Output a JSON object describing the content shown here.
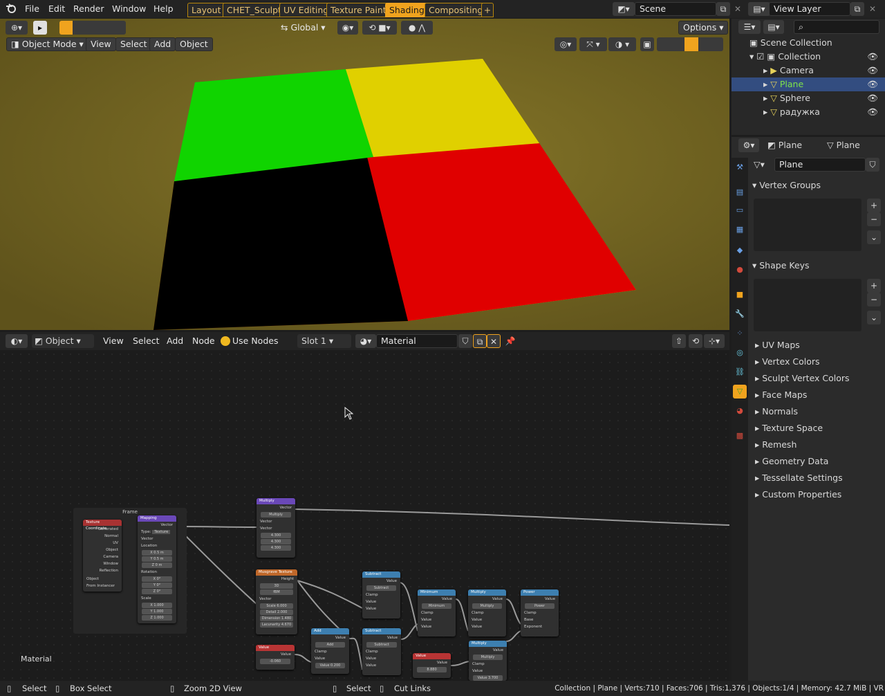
{
  "menu": [
    "File",
    "Edit",
    "Render",
    "Window",
    "Help"
  ],
  "workspaces": [
    "Layout",
    "CHET_Sculpt",
    "UV Editing",
    "Texture Paint",
    "Shading",
    "Compositing"
  ],
  "active_workspace": "Shading",
  "add_tab": "+",
  "scene": "Scene",
  "view_layer": "View Layer",
  "viewport": {
    "orientation": "Global",
    "options": "Options",
    "mode": "Object Mode",
    "menus": [
      "View",
      "Select",
      "Add",
      "Object"
    ]
  },
  "node_header": {
    "editor": "Object",
    "menus": [
      "View",
      "Select",
      "Add",
      "Node"
    ],
    "use_nodes": "Use Nodes",
    "slot": "Slot 1",
    "material": "Material"
  },
  "outliner": {
    "root": "Scene Collection",
    "collection": "Collection",
    "items": [
      "Camera",
      "Plane",
      "Sphere",
      "радужка"
    ],
    "selected": "Plane"
  },
  "properties": {
    "object": "Plane",
    "data": "Plane",
    "mesh": "Plane",
    "panels_open": [
      "Vertex Groups",
      "Shape Keys"
    ],
    "panels": [
      "UV Maps",
      "Vertex Colors",
      "Sculpt Vertex Colors",
      "Face Maps",
      "Normals",
      "Texture Space",
      "Remesh",
      "Geometry Data",
      "Tessellate Settings",
      "Custom Properties"
    ]
  },
  "nodes": {
    "frame": "Frame",
    "material_label": "Material",
    "texcoord": {
      "title": "Texture Coordinate",
      "outs": [
        "Generated",
        "Normal",
        "UV",
        "Object",
        "Camera",
        "Window",
        "Reflection"
      ],
      "object": "Object",
      "instancer": "From Instancer"
    },
    "mapping": {
      "title": "Mapping",
      "out": "Vector",
      "type_label": "Type:",
      "type": "Texture",
      "vector": "Vector",
      "loc": "Location",
      "rot": "Rotation",
      "scale": "Scale",
      "loc_vals": [
        "X  0.5 m",
        "Y  0.5 m",
        "Z  0 m"
      ],
      "rot_vals": [
        "X  0°",
        "Y  0°",
        "Z  0°"
      ],
      "scale_vals": [
        "X  1.000",
        "Y  1.000",
        "Z  1.000"
      ]
    },
    "vmul": {
      "title": "Multiply",
      "out": "Vector",
      "op": "Multiply",
      "in1": "Vector",
      "in2": "Vector",
      "vals": [
        "4.300",
        "4.300",
        "4.300"
      ]
    },
    "musgrave": {
      "title": "Musgrave Texture",
      "out": "Height",
      "dim": "3D",
      "type": "fBM",
      "vec": "Vector",
      "fields": [
        "Scale  6.000",
        "Detail  2.000",
        "Dimension  1.480",
        "Lacunarity  4.670"
      ]
    },
    "value1": {
      "title": "Value",
      "out": "Value",
      "val": "-0.060"
    },
    "add": {
      "title": "Add",
      "out": "Value",
      "op": "Add",
      "clamp": "Clamp",
      "in1": "Value",
      "val": "Value  0.200"
    },
    "sub1": {
      "title": "Subtract",
      "out": "Value",
      "op": "Subtract",
      "clamp": "Clamp",
      "in1": "Value",
      "in2": "Value"
    },
    "sub2": {
      "title": "Subtract",
      "out": "Value",
      "op": "Subtract",
      "clamp": "Clamp",
      "in1": "Value",
      "in2": "Value"
    },
    "min": {
      "title": "Minimum",
      "out": "Value",
      "op": "Minimum",
      "clamp": "Clamp",
      "in1": "Value",
      "in2": "Value"
    },
    "mul1": {
      "title": "Multiply",
      "out": "Value",
      "op": "Multiply",
      "clamp": "Clamp",
      "in1": "Value",
      "in2": "Value"
    },
    "power": {
      "title": "Power",
      "out": "Value",
      "op": "Power",
      "clamp": "Clamp",
      "in1": "Base",
      "in2": "Exponent"
    },
    "value2": {
      "title": "Value",
      "out": "Value",
      "val": "8.880"
    },
    "mul2": {
      "title": "Multiply",
      "out": "Value",
      "op": "Multiply",
      "clamp": "Clamp",
      "in1": "Value",
      "val": "Value  3.700"
    }
  },
  "status": {
    "select": "Select",
    "box_select": "Box Select",
    "zoom": "Zoom 2D View",
    "select2": "Select",
    "cut": "Cut Links",
    "info": "Collection | Plane | Verts:710 | Faces:706 | Tris:1,376 | Objects:1/4 | Memory: 42.7 MiB | VR"
  },
  "colors": {
    "accent": "#f0a31e",
    "selection": "#334d80",
    "plane_highlight": "#7ee34a"
  }
}
